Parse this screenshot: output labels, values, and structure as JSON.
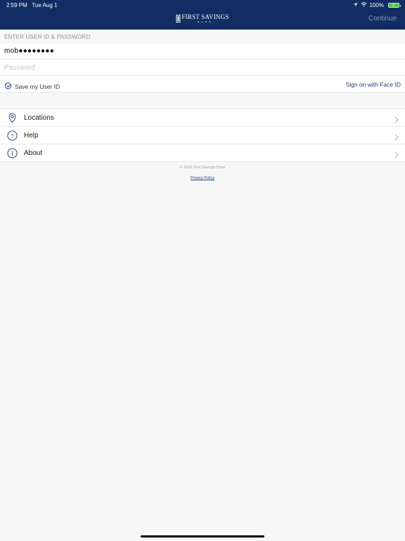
{
  "status_bar": {
    "time": "2:59 PM",
    "date": "Tue Aug 1",
    "battery": "100%"
  },
  "header": {
    "logo_name": "FIRST SAVINGS",
    "logo_sub": "BANK",
    "continue_label": "Continue"
  },
  "login": {
    "section_label": "ENTER USER ID & PASSWORD",
    "user_id_value": "mob●●●●●●●●",
    "password_placeholder": "Password",
    "save_user_id_label": "Save my User ID",
    "face_id_label": "Sign on with Face ID"
  },
  "menu": {
    "items": [
      {
        "label": "Locations",
        "icon": "location-pin-icon"
      },
      {
        "label": "Help",
        "icon": "help-icon"
      },
      {
        "label": "About",
        "icon": "info-icon"
      }
    ]
  },
  "footer": {
    "copyright": "© 2023 First Savings Bank",
    "privacy_label": "Privacy Policy"
  },
  "colors": {
    "header_bg": "#112d63",
    "link": "#1d3f73",
    "battery": "#34c759"
  }
}
